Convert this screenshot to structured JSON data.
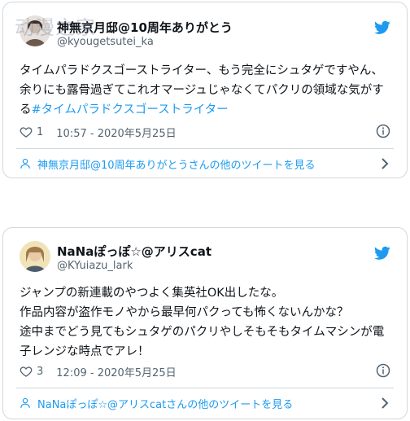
{
  "watermark": "动漫之家",
  "tweets": [
    {
      "name": "神無京月邸@10周年ありがとう",
      "handle": "@kyougetsutei_ka",
      "text": "タイムパラドクスゴーストライター、もう完全にシュタゲですやん、余りにも露骨過ぎてこれオマージュじゃなくてパクリの領域な気がする",
      "hashtag": "#タイムパラドクスゴーストライター",
      "likes": "1",
      "timestamp": "10:57 - 2020年5月25日",
      "more_link": "神無京月邸@10周年ありがとうさんの他のツイートを見る"
    },
    {
      "name": "NaNaぽっぽ☆@アリスcat",
      "handle": "@KYuiazu_lark",
      "text": "ジャンプの新連載のやつよく集英社OK出したな。\n作品内容が盗作モノやから最早何パクっても怖くないんかな？\n途中までどう見てもシュタゲのパクリやしそもそもタイムマシンが電子レンジな時点でアレ！",
      "likes": "3",
      "timestamp": "12:09 - 2020年5月25日",
      "more_link": "NaNaぽっぽ☆@アリスcatさんの他のツイートを見る"
    }
  ],
  "icons": [
    "twitter-bird-icon",
    "heart-icon",
    "info-icon",
    "person-icon",
    "chevron-right-icon"
  ],
  "colors": {
    "accent": "#1d9bf0",
    "text": "#0f1419",
    "secondary": "#536471",
    "border": "#cfd9de"
  }
}
